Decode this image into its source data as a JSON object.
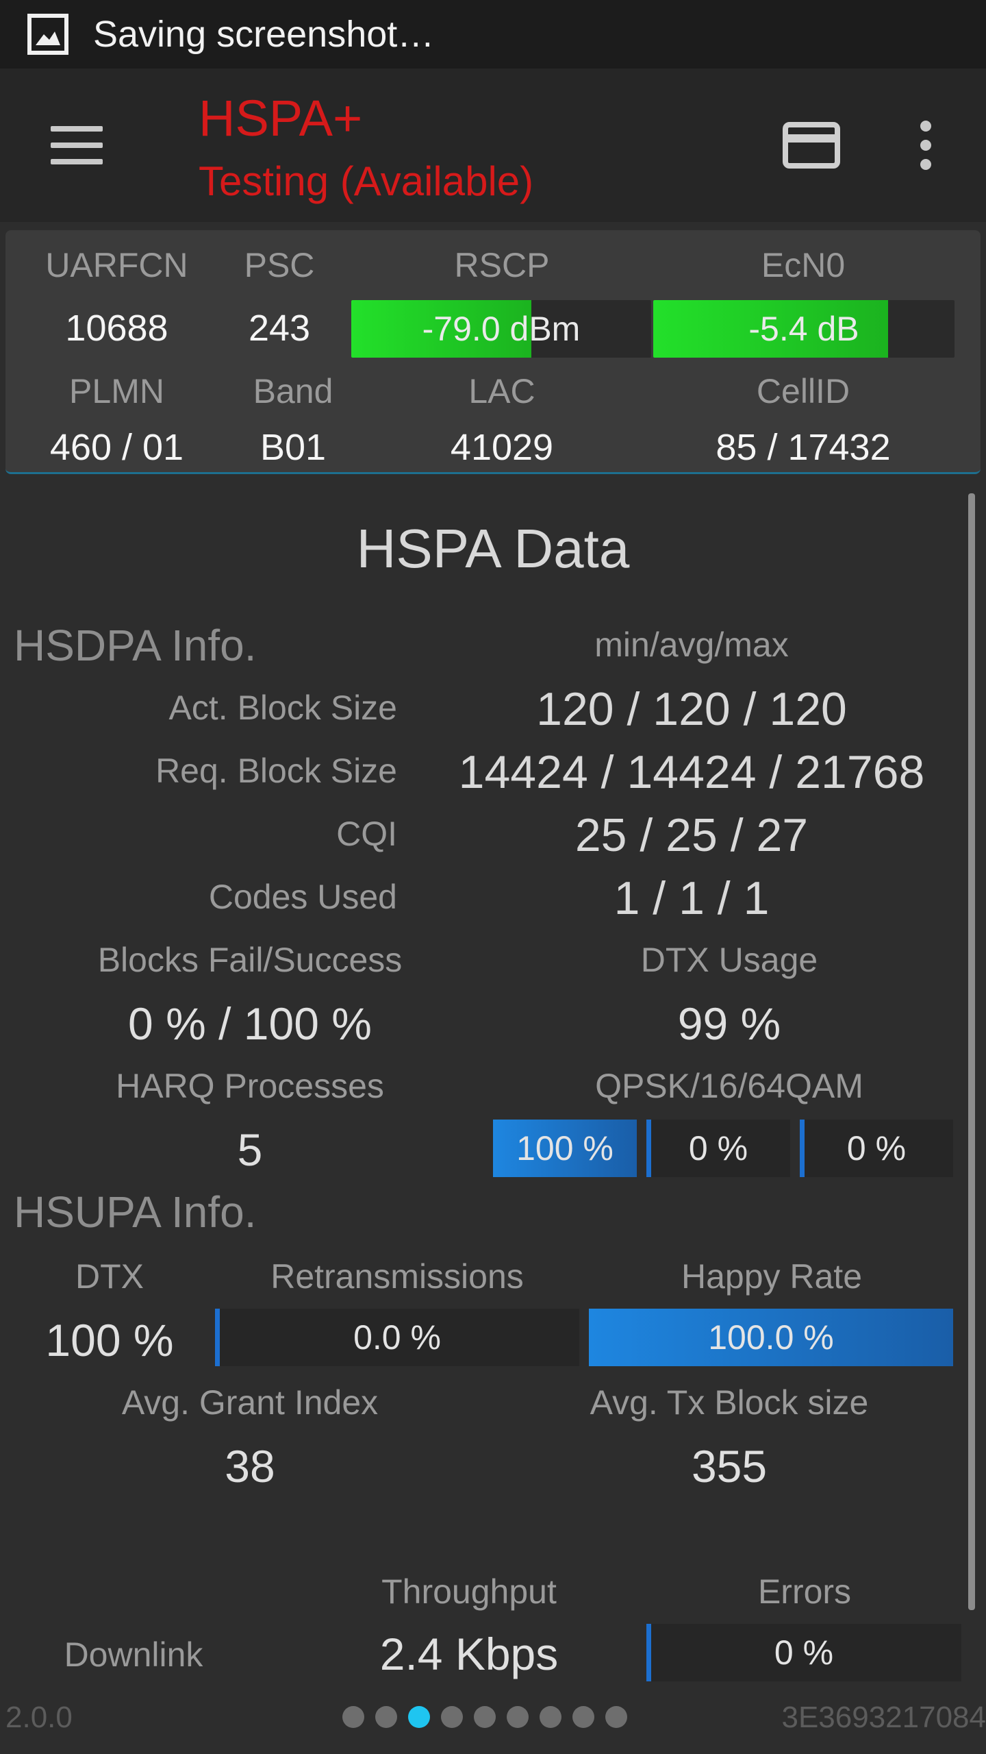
{
  "status_bar": {
    "text": "Saving screenshot…"
  },
  "app_bar": {
    "title": "HSPA+",
    "subtitle": "Testing (Available)"
  },
  "cell": {
    "labels": {
      "uarfcn": "UARFCN",
      "psc": "PSC",
      "rscp": "RSCP",
      "ecn0": "EcN0",
      "plmn": "PLMN",
      "band": "Band",
      "lac": "LAC",
      "cellid": "CellID"
    },
    "uarfcn": "10688",
    "psc": "243",
    "rscp": {
      "text": "-79.0 dBm",
      "level": 0.6
    },
    "ecn0": {
      "text": "-5.4 dB",
      "level": 0.78
    },
    "plmn": "460 / 01",
    "band": "B01",
    "lac": "41029",
    "cellid": "85 / 17432"
  },
  "hspa": {
    "title": "HSPA Data",
    "hsdpa": {
      "heading": "HSDPA Info.",
      "col_header": "min/avg/max",
      "rows": [
        {
          "label": "Act. Block Size",
          "value": "120 / 120 / 120"
        },
        {
          "label": "Req. Block Size",
          "value": "14424 / 14424 / 21768"
        },
        {
          "label": "CQI",
          "value": "25 / 25 / 27"
        },
        {
          "label": "Codes Used",
          "value": "1 / 1 / 1"
        }
      ],
      "blocks_label": "Blocks Fail/Success",
      "blocks_value": "0 % / 100 %",
      "dtx_label": "DTX Usage",
      "dtx_value": "99 %",
      "harq_label": "HARQ Processes",
      "harq_value": "5",
      "qam_label": "QPSK/16/64QAM",
      "qam": [
        {
          "text": "100 %",
          "level": 1.0
        },
        {
          "text": "0 %",
          "level": 0.0
        },
        {
          "text": "0 %",
          "level": 0.0
        }
      ]
    },
    "hsupa": {
      "heading": "HSUPA Info.",
      "dtx_label": "DTX",
      "dtx_value": "100 %",
      "retx_label": "Retransmissions",
      "retx": {
        "text": "0.0 %",
        "level": 0.0
      },
      "happy_label": "Happy Rate",
      "happy": {
        "text": "100.0 %",
        "level": 1.0
      },
      "grant_label": "Avg. Grant Index",
      "grant_value": "38",
      "txblock_label": "Avg. Tx Block size",
      "txblock_value": "355"
    },
    "throughput": {
      "col_throughput": "Throughput",
      "col_errors": "Errors",
      "row_label": "Downlink",
      "downlink_value": "2.4 Kbps",
      "errors": {
        "text": "0 %",
        "level": 0.0
      }
    }
  },
  "footer": {
    "version": "2.0.0",
    "device_id": "3E3693217084",
    "page_count": 9,
    "active_page": 3
  }
}
